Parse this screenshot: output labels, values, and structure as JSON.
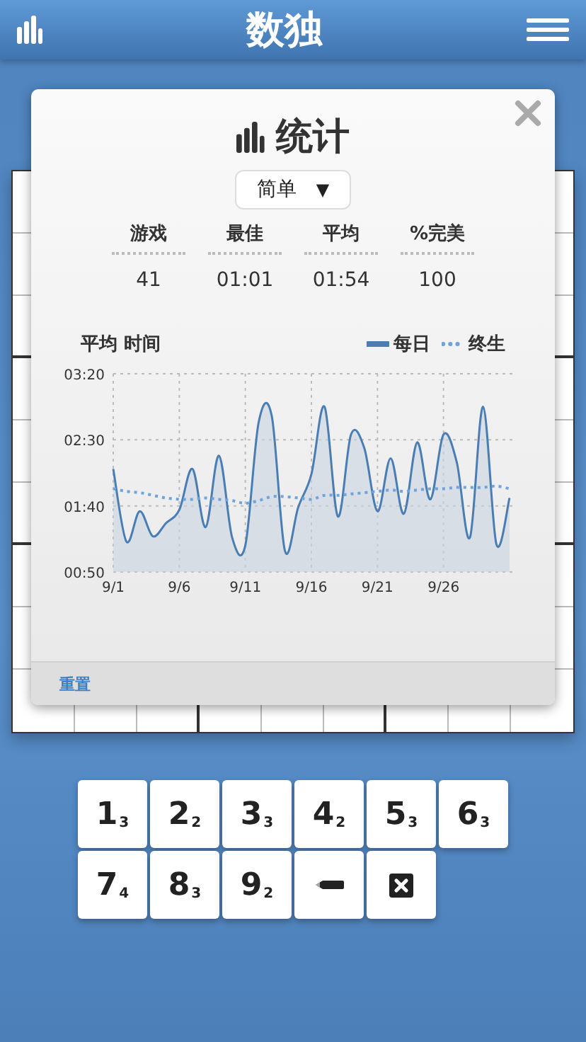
{
  "header": {
    "title": "数独"
  },
  "stats_dialog": {
    "title": "统计",
    "difficulty": {
      "value": "简单",
      "caret": "▼"
    },
    "stats": [
      {
        "label": "游戏",
        "value": "41"
      },
      {
        "label": "最佳",
        "value": "01:01"
      },
      {
        "label": "平均",
        "value": "01:54"
      },
      {
        "label": "%完美",
        "value": "100"
      }
    ],
    "chart_data": {
      "type": "area",
      "title": "平均 时间",
      "ylim": [
        50,
        200
      ],
      "grid": true,
      "yticks": [
        {
          "value": 50,
          "label": "00:50"
        },
        {
          "value": 100,
          "label": "01:40"
        },
        {
          "value": 150,
          "label": "02:30"
        },
        {
          "value": 200,
          "label": "03:20"
        }
      ],
      "categories": [
        "9/1",
        null,
        null,
        null,
        null,
        "9/6",
        null,
        null,
        null,
        null,
        "9/11",
        null,
        null,
        null,
        null,
        "9/16",
        null,
        null,
        null,
        null,
        "9/21",
        null,
        null,
        null,
        null,
        "9/26",
        null,
        null,
        null,
        null,
        null
      ],
      "series": [
        {
          "name": "每日",
          "color": "#4a7db3",
          "type": "area",
          "line_style": "solid",
          "values": [
            128,
            73,
            96,
            77,
            87,
            97,
            128,
            84,
            138,
            76,
            70,
            163,
            168,
            66,
            99,
            124,
            175,
            92,
            154,
            144,
            96,
            136,
            94,
            148,
            105,
            154,
            133,
            76,
            175,
            71,
            106
          ]
        },
        {
          "name": "终生",
          "color": "#6fa3dc",
          "type": "line",
          "line_style": "dotted",
          "values": [
            113,
            111,
            110,
            108,
            106,
            105,
            105,
            106,
            105,
            104,
            102,
            104,
            107,
            107,
            106,
            105,
            108,
            108,
            109,
            110,
            111,
            112,
            111,
            112,
            113,
            113,
            114,
            114,
            114,
            115,
            113
          ]
        }
      ]
    },
    "footer_link": "重置"
  },
  "keypad": [
    {
      "kind": "digit",
      "digit": "1",
      "count": "3"
    },
    {
      "kind": "digit",
      "digit": "2",
      "count": "2"
    },
    {
      "kind": "digit",
      "digit": "3",
      "count": "3"
    },
    {
      "kind": "digit",
      "digit": "4",
      "count": "2"
    },
    {
      "kind": "digit",
      "digit": "5",
      "count": "3"
    },
    {
      "kind": "digit",
      "digit": "6",
      "count": "3"
    },
    {
      "kind": "digit",
      "digit": "7",
      "count": "4"
    },
    {
      "kind": "digit",
      "digit": "8",
      "count": "3"
    },
    {
      "kind": "digit",
      "digit": "9",
      "count": "2"
    },
    {
      "kind": "pencil"
    },
    {
      "kind": "erase"
    }
  ]
}
